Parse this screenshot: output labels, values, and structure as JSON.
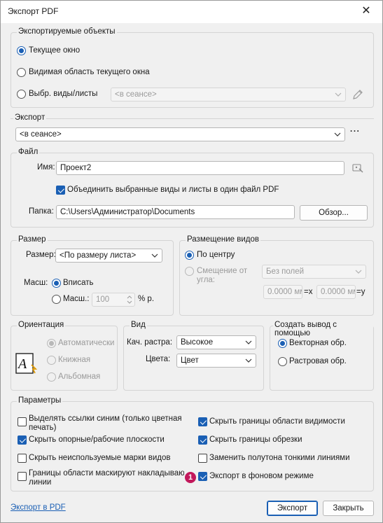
{
  "window": {
    "title": "Экспорт PDF",
    "close_glyph": "✕"
  },
  "export_objects": {
    "label": "Экспортируемые объекты",
    "current_window": "Текущее окно",
    "visible_area": "Видимая область текущего окна",
    "selected_views": "Выбр. виды/листы",
    "in_session": "<в сеансе>"
  },
  "export": {
    "label": "Экспорт",
    "value": "<в сеансе>",
    "more": "···"
  },
  "file": {
    "label": "Файл",
    "name_label": "Имя:",
    "name_value": "Проект2",
    "combine_label": "Объединить выбранные виды и листы в один файл PDF",
    "folder_label": "Папка:",
    "folder_value": "C:\\Users\\Администратор\\Documents",
    "browse": "Обзор..."
  },
  "size": {
    "label": "Размер",
    "size_label": "Размер:",
    "size_value": "<По размеру листа>",
    "scale_label": "Масш:",
    "fit": "Вписать",
    "scale_opt": "Масш.:",
    "scale_value": "100",
    "pct": "% р."
  },
  "placement": {
    "label": "Размещение видов",
    "center": "По центру",
    "offset_line1": "Смещение от",
    "offset_line2": "угла:",
    "margins": "Без полей",
    "x_value": "0.0000 мм",
    "x_label": "=x",
    "y_value": "0.0000 мм",
    "y_label": "=y"
  },
  "orientation": {
    "label": "Ориентация",
    "auto": "Автоматически",
    "portrait": "Книжная",
    "landscape": "Альбомная"
  },
  "view": {
    "label": "Вид",
    "raster_label": "Кач. растра:",
    "raster_value": "Высокое",
    "colors_label": "Цвета:",
    "colors_value": "Цвет"
  },
  "output": {
    "label": "Создать вывод с помощью",
    "vector": "Векторная обр.",
    "raster": "Растровая обр."
  },
  "params": {
    "label": "Параметры",
    "links_blue_1": "Выделять ссылки синим (только цветная",
    "links_blue_2": "печать)",
    "hide_ref_planes": "Скрыть опорные/рабочие плоскости",
    "hide_unused_tags": "Скрыть неиспользуемые марки видов",
    "mask_1": "Границы области маскируют накладываю",
    "mask_2": "линии",
    "hide_scope_boxes": "Скрыть границы области видимости",
    "hide_crop": "Скрыть границы обрезки",
    "replace_halftone": "Заменить полутона тонкими линиями",
    "background": "Экспорт в фоновом режиме"
  },
  "footer": {
    "link": "Экспорт в PDF",
    "export": "Экспорт",
    "close": "Закрыть"
  },
  "badge": "1",
  "colors": {
    "accent": "#1a5fb4",
    "badge": "#c2185b"
  }
}
